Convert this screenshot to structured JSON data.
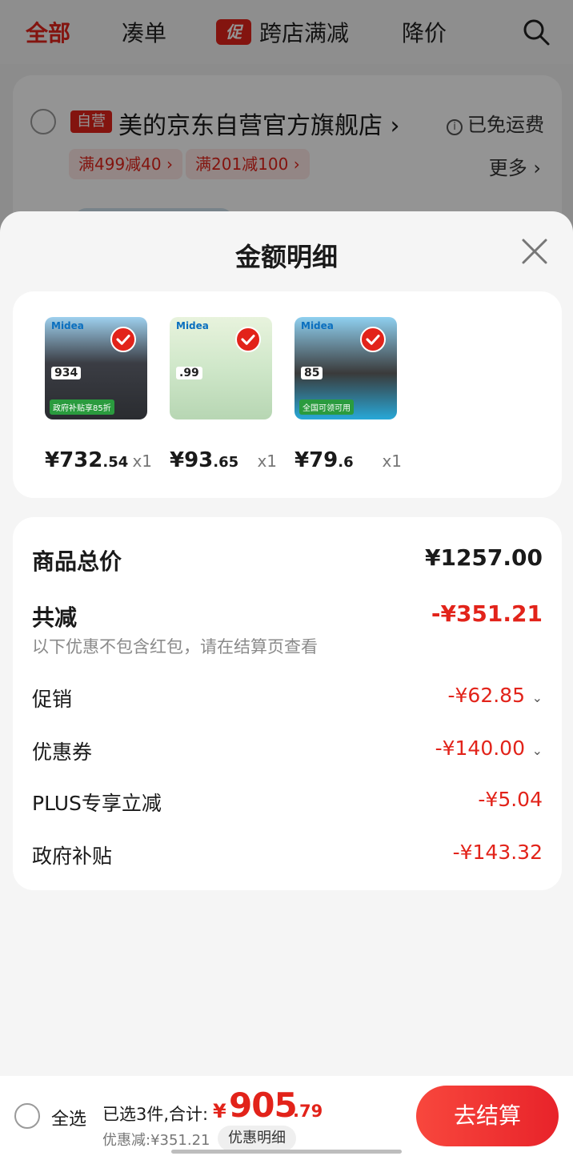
{
  "top_tabs": {
    "all": "全部",
    "bundle": "凑单",
    "promo_badge": "促",
    "cross_store": "跨店满减",
    "price_drop": "降价"
  },
  "store": {
    "self_badge": "自营",
    "name": "美的京东自营官方旗舰店 ›",
    "free_shipping": "已免运费",
    "coupons": [
      "满499减40 ›",
      "满201减100 ›"
    ],
    "more": "更多 ›"
  },
  "sheet": {
    "title": "金额明细",
    "items": [
      {
        "brand": "Midea",
        "thumb_price": "934",
        "tag": "政府补贴享85折",
        "price_int": "¥732",
        "price_dec": ".54",
        "qty": "x1"
      },
      {
        "brand": "Midea",
        "thumb_price": ".99",
        "tag": "",
        "price_int": "¥93",
        "price_dec": ".65",
        "qty": "x1"
      },
      {
        "brand": "Midea",
        "thumb_price": "85",
        "tag": "全国可领可用",
        "price_int": "¥79",
        "price_dec": ".6",
        "qty": "x1"
      }
    ],
    "summary": {
      "total_label": "商品总价",
      "total_value": "¥1257.00",
      "reduce_label": "共减",
      "reduce_value": "-¥351.21",
      "note": "以下优惠不包含红包，请在结算页查看",
      "rows": [
        {
          "label": "促销",
          "value": "-¥62.85",
          "expandable": true
        },
        {
          "label": "优惠券",
          "value": "-¥140.00",
          "expandable": true
        },
        {
          "label": "PLUS专享立减",
          "value": "-¥5.04",
          "expandable": false
        },
        {
          "label": "政府补贴",
          "value": "-¥143.32",
          "expandable": false
        }
      ]
    }
  },
  "bottom_bar": {
    "select_all": "全选",
    "selected_text": "已选3件,合计:",
    "currency": "¥",
    "total_int": "905",
    "total_dec": ".79",
    "discount": "优惠减:¥351.21",
    "detail_button": "优惠明细",
    "checkout_button": "去结算"
  },
  "colors": {
    "accent": "#e2231a",
    "sheet_bg": "#f5f5f5"
  }
}
